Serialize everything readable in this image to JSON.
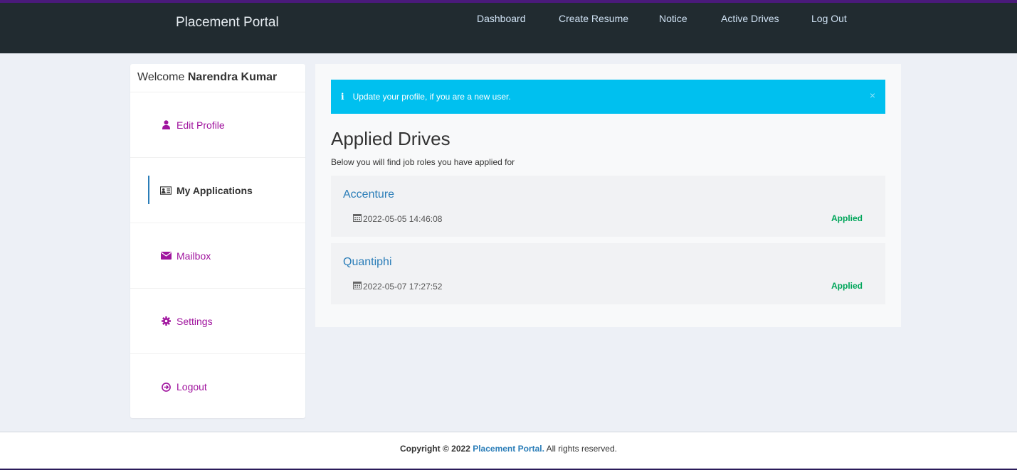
{
  "header": {
    "brand": "Placement Portal",
    "nav": [
      "Dashboard",
      "Create Resume",
      "Notice",
      "Active Drives",
      "Log Out"
    ]
  },
  "sidebar": {
    "welcome_prefix": "Welcome",
    "user_name": "Narendra Kumar",
    "items": [
      {
        "label": "Edit Profile",
        "icon": "user-icon"
      },
      {
        "label": "My Applications",
        "icon": "id-card-icon",
        "active": true
      },
      {
        "label": "Mailbox",
        "icon": "envelope-icon"
      },
      {
        "label": "Settings",
        "icon": "gear-icon"
      },
      {
        "label": "Logout",
        "icon": "sign-out-icon"
      }
    ]
  },
  "alert": {
    "text": "Update your profile, if you are a new user.",
    "close": "×"
  },
  "main": {
    "title": "Applied Drives",
    "subtitle": "Below you will find job roles you have applied for",
    "drives": [
      {
        "company": "Accenture",
        "date": "2022-05-05 14:46:08",
        "status": "Applied"
      },
      {
        "company": "Quantiphi",
        "date": "2022-05-07 17:27:52",
        "status": "Applied"
      }
    ]
  },
  "footer": {
    "prefix": "Copyright © 2022",
    "link": "Placement Portal.",
    "suffix": "All rights reserved."
  },
  "colors": {
    "nav_bg": "#212b30",
    "accent": "#a0149e",
    "alert": "#00c0ef",
    "link": "#2a7db8",
    "status": "#00a65a"
  }
}
